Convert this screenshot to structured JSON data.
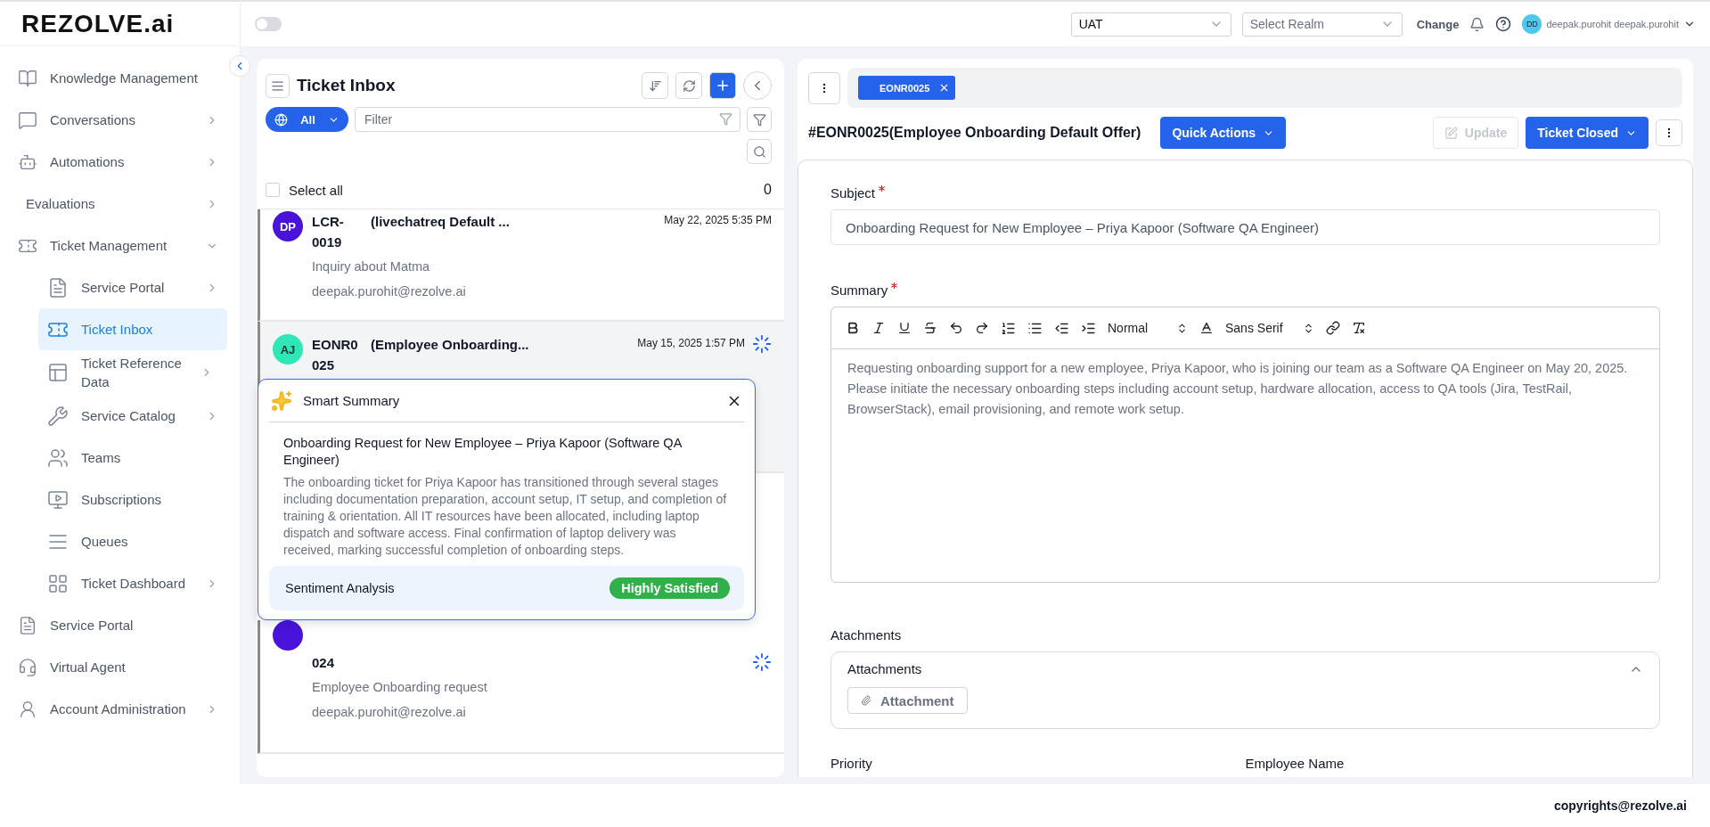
{
  "header": {
    "logo": "REZOLVE.ai",
    "toggle": {
      "on": false
    },
    "environment": {
      "value": "UAT"
    },
    "realm": {
      "placeholder": "Select Realm"
    },
    "change": "Change",
    "user": {
      "initials": "DD",
      "name": "deepak.purohit deepak.purohit"
    }
  },
  "sidebar": {
    "items": [
      {
        "label": "Knowledge Management",
        "expandable": false,
        "selected": false
      },
      {
        "label": "Conversations",
        "expandable": true,
        "expanded": false,
        "selected": false
      },
      {
        "label": "Automations",
        "expandable": true,
        "expanded": false,
        "selected": false
      },
      {
        "label": "Evaluations",
        "expandable": true,
        "expanded": false,
        "selected": false
      },
      {
        "label": "Ticket Management",
        "expandable": true,
        "expanded": true,
        "selected": false,
        "children": [
          {
            "label": "Service Portal",
            "expandable": true,
            "expanded": false,
            "selected": false
          },
          {
            "label": "Ticket Inbox",
            "expandable": false,
            "selected": true
          },
          {
            "label": "Ticket Reference Data",
            "expandable": true,
            "expanded": false,
            "selected": false
          },
          {
            "label": "Service Catalog",
            "expandable": true,
            "expanded": false,
            "selected": false
          },
          {
            "label": "Teams",
            "expandable": false,
            "selected": false
          },
          {
            "label": "Subscriptions",
            "expandable": false,
            "selected": false
          },
          {
            "label": "Queues",
            "expandable": false,
            "selected": false
          },
          {
            "label": "Ticket Dashboard",
            "expandable": true,
            "expanded": false,
            "selected": false
          }
        ]
      },
      {
        "label": "Service Portal",
        "expandable": false,
        "selected": false
      },
      {
        "label": "Virtual Agent",
        "expandable": false,
        "selected": false
      },
      {
        "label": "Account Administration",
        "expandable": true,
        "expanded": false,
        "selected": false
      }
    ]
  },
  "inbox": {
    "title": "Ticket Inbox",
    "scope": "All",
    "filter": {
      "placeholder": "Filter"
    },
    "select_all": {
      "label": "Select all",
      "checked": false
    },
    "count": "0",
    "tickets": [
      {
        "initials": "DP",
        "color": "#4a13da",
        "id": "LCR-0019",
        "title": "(livechatreq Default ...",
        "date": "May 22, 2025 5:35 PM",
        "subject": "Inquiry about Matma",
        "email": "deepak.purohit@rezolve.ai",
        "selected": false,
        "loading": false
      },
      {
        "initials": "AJ",
        "color": "#2ee6b6",
        "id": "EONR0025",
        "title": "(Employee Onboarding...",
        "date": "May 15, 2025 1:57 PM",
        "selected": true,
        "loading": true
      },
      {
        "color": "#4a13da",
        "id": "024",
        "subject": "Employee Onboarding request",
        "email": "deepak.purohit@rezolve.ai",
        "selected": false,
        "loading": true
      }
    ],
    "smart_summary": {
      "heading": "Smart Summary",
      "title": "Onboarding Request for New Employee – Priya Kapoor (Software QA Engineer)",
      "body": "The onboarding ticket for Priya Kapoor has transitioned through several stages including documentation preparation, account setup, IT setup, and completion of training & orientation. All IT resources have been allocated, including laptop dispatch and software access. Final confirmation of laptop delivery was received, marking successful completion of onboarding steps.",
      "sentiment_label": "Sentiment Analysis",
      "sentiment": "Highly Satisfied"
    }
  },
  "detail": {
    "tabs": [
      {
        "label": "EONR0025",
        "selected": true
      }
    ],
    "title": "#EONR0025(Employee Onboarding Default Offer)",
    "quick_actions": "Quick Actions",
    "update": {
      "label": "Update",
      "disabled": true
    },
    "status": "Ticket Closed",
    "subject": {
      "label": "Subject",
      "required": true,
      "value": "Onboarding Request for New Employee – Priya Kapoor (Software QA Engineer)"
    },
    "summary": {
      "label": "Summary",
      "required": true,
      "format": "Normal",
      "font": "Sans Serif",
      "value": "Requesting onboarding support for a new employee, Priya Kapoor, who is joining our team as a Software QA Engineer on May 20, 2025. Please initiate the necessary onboarding steps including account setup, hardware allocation, access to QA tools (Jira, TestRail, BrowserStack), email provisioning, and remote work setup."
    },
    "attachments_label": "Atachments",
    "attachments": {
      "title": "Attachments",
      "expanded": true,
      "button": "Attachment"
    },
    "next_fields": [
      "Priority",
      "Employee Name"
    ]
  },
  "footer": {
    "copyright": "copyrights@rezolve.ai"
  }
}
